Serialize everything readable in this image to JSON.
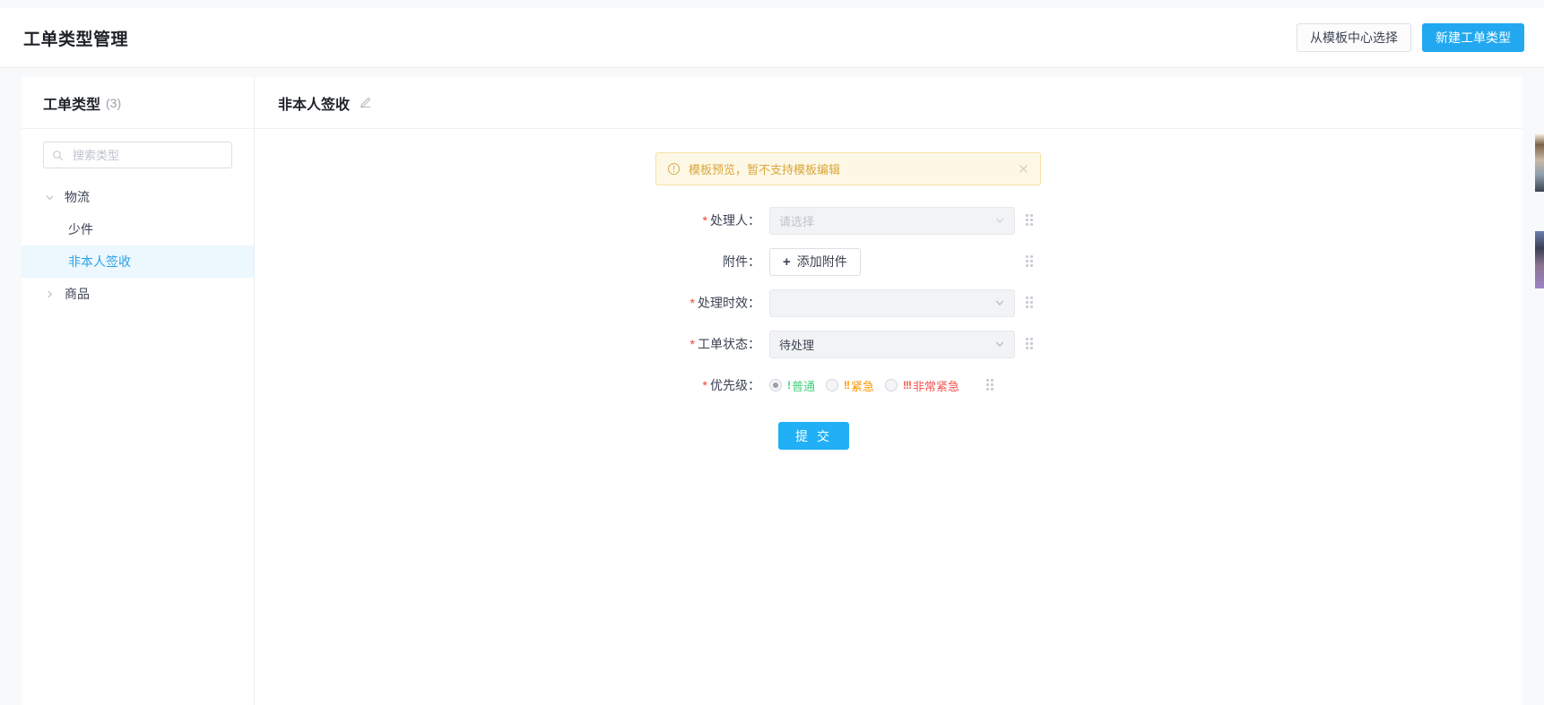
{
  "header": {
    "title": "工单类型管理",
    "buttons": {
      "template_center": "从模板中心选择",
      "new_type": "新建工单类型"
    }
  },
  "sidebar": {
    "title": "工单类型",
    "count": "(3)",
    "search": {
      "placeholder": "搜索类型",
      "value": "",
      "icon": "search-icon"
    },
    "tree": [
      {
        "label": "物流",
        "level": 0,
        "expanded": true,
        "selected": false,
        "icon": "chevron-down-icon"
      },
      {
        "label": "少件",
        "level": 1,
        "expanded": false,
        "selected": false,
        "icon": ""
      },
      {
        "label": "非本人签收",
        "level": 1,
        "expanded": false,
        "selected": true,
        "icon": ""
      },
      {
        "label": "商品",
        "level": 0,
        "expanded": false,
        "selected": false,
        "icon": "chevron-right-icon"
      }
    ]
  },
  "content": {
    "title": "非本人签收",
    "edit_icon": "pencil-icon",
    "alert": {
      "icon": "exclamation-circle-icon",
      "text": "模板预览，暂不支持模板编辑",
      "close_icon": "close-icon",
      "bg_color": "#fdf8e6",
      "border_color": "#f5e2a3",
      "text_color": "#d9a63a"
    },
    "form": {
      "fields": [
        {
          "label": "处理人：",
          "required": true,
          "type": "select",
          "value": "",
          "placeholder": "请选择",
          "disabled": true
        },
        {
          "label": "附件：",
          "required": false,
          "type": "button",
          "button_label": "添加附件",
          "button_icon": "plus-icon"
        },
        {
          "label": "处理时效：",
          "required": true,
          "type": "select",
          "value": "",
          "placeholder": "",
          "disabled": true
        },
        {
          "label": "工单状态：",
          "required": true,
          "type": "select",
          "value": "待处理",
          "placeholder": "",
          "disabled": true
        },
        {
          "label": "优先级：",
          "required": true,
          "type": "radio",
          "options": [
            {
              "mark": "!",
              "label": "普通",
              "color": "#44cf7c",
              "checked": true
            },
            {
              "mark": "!!",
              "label": "紧急",
              "color": "#ff9500",
              "checked": false
            },
            {
              "mark": "!!!",
              "label": "非常紧急",
              "color": "#f5534c",
              "checked": false
            }
          ]
        }
      ],
      "submit_label": "提 交",
      "drag_handle_icon": "drag-handle-icon"
    }
  },
  "colors": {
    "primary": "#21a8f0",
    "submit": "#21b0f5",
    "selected_item": "#2ba3e8",
    "selected_bg": "#ecf7fe",
    "required_star": "#f04134"
  }
}
